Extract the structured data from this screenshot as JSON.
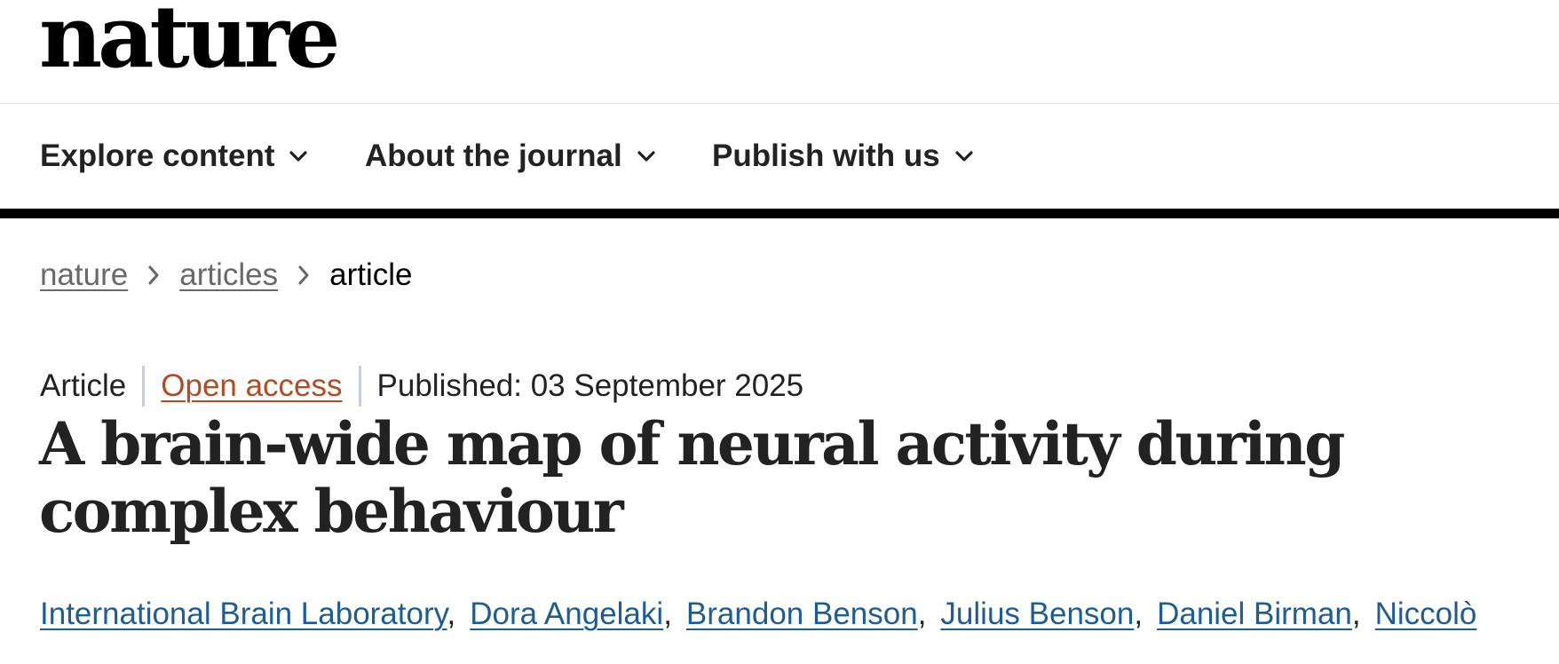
{
  "header": {
    "logo_text": "nature"
  },
  "nav": {
    "items": [
      {
        "label": "Explore content",
        "icon": "chevron-down-icon"
      },
      {
        "label": "About the journal",
        "icon": "chevron-down-icon"
      },
      {
        "label": "Publish with us",
        "icon": "chevron-down-icon"
      }
    ]
  },
  "breadcrumb": {
    "items": [
      {
        "label": "nature"
      },
      {
        "label": "articles"
      }
    ],
    "current": "article"
  },
  "article": {
    "type": "Article",
    "access": "Open access",
    "published": "Published: 03 September 2025",
    "title": "A brain-wide map of neural activity during complex behaviour",
    "authors": [
      "International Brain Laboratory",
      "Dora Angelaki",
      "Brandon Benson",
      "Julius Benson",
      "Daniel Birman",
      "Niccolò"
    ]
  },
  "colors": {
    "link_blue": "#1e5d93",
    "open_access_orange": "#b44c22",
    "breadcrumb_gray": "#696969",
    "rule_black": "#000000"
  }
}
